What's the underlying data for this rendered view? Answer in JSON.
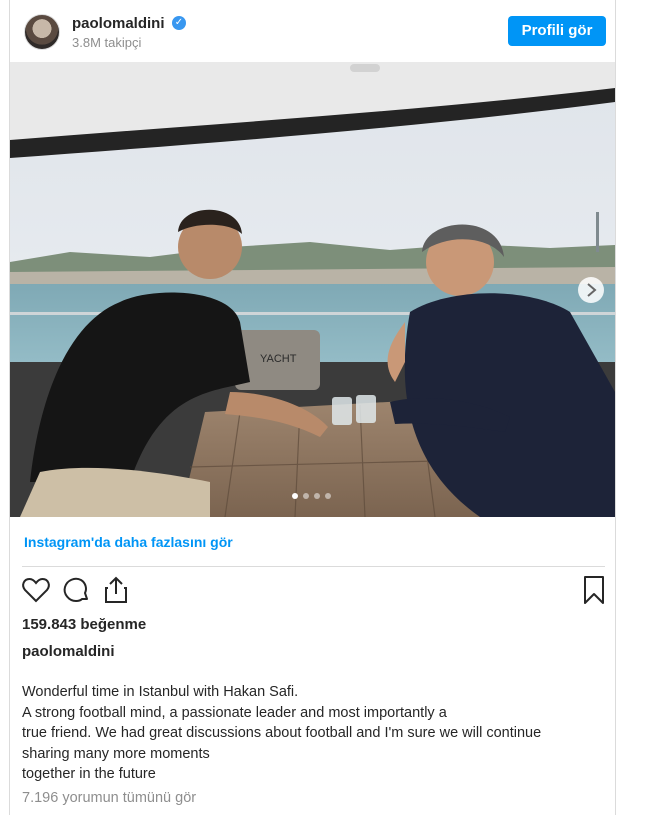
{
  "header": {
    "username": "paolomaldini",
    "followers": "3.8M takipçi",
    "profile_button": "Profili gör"
  },
  "photo": {
    "description_icon": "boat-meeting-photo",
    "carousel_dots": 4,
    "active_dot": 1
  },
  "more_link": "Instagram'da daha fazlasını gör",
  "likes": "159.843 beğenme",
  "caption": {
    "author": "paolomaldini",
    "lines": [
      "Wonderful time in Istanbul with Hakan Safi.",
      "A strong football mind, a passionate leader and most importantly a",
      "true friend. We had great discussions about football and I'm sure we will continue",
      "sharing many more moments",
      "together in the future"
    ]
  },
  "comments_link": "7.196 yorumun tümünü gör",
  "colors": {
    "accent": "#0095f6",
    "verified": "#3897f0",
    "muted": "#8e8e8e"
  }
}
